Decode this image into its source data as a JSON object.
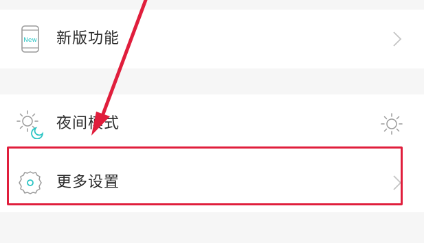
{
  "settings": {
    "items": [
      {
        "label": "新版功能",
        "icon": "new-features-phone-icon",
        "icon_text": "New",
        "trailing": "chevron-right-icon"
      },
      {
        "label": "夜间模式",
        "icon": "night-mode-icon",
        "trailing": "sun-toggle-icon"
      },
      {
        "label": "更多设置",
        "icon": "gear-icon",
        "trailing": "chevron-right-icon"
      }
    ]
  },
  "annotation": {
    "highlight_color": "#e01e3c",
    "arrow_color": "#e01e3c",
    "highlighted_item": "更多设置"
  },
  "colors": {
    "accent_teal": "#2bc4c4",
    "icon_gray": "#9a9a9a",
    "text": "#2b2b2b",
    "divider_bg": "#f6f6f6"
  }
}
